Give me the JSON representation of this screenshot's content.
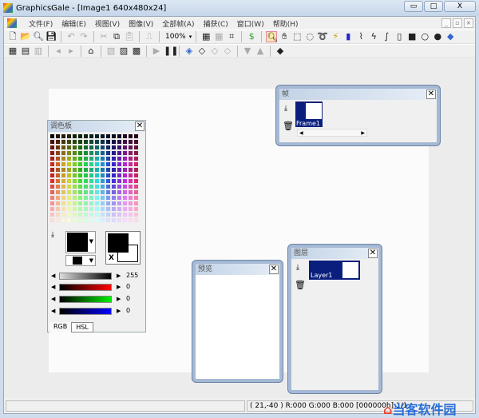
{
  "window": {
    "title": "GraphicsGale - [Image1 640x480x24]",
    "min": "▭",
    "max": "□",
    "close": "X"
  },
  "menu": [
    "文件(F)",
    "编辑(E)",
    "视图(V)",
    "图像(V)",
    "全部帧(A)",
    "捕获(C)",
    "窗口(W)",
    "帮助(H)"
  ],
  "mdi": [
    "_",
    "▫",
    "×"
  ],
  "toolbar1": {
    "zoom": "100%"
  },
  "palette": {
    "title": "调色板",
    "close": "✕",
    "gray_value": "255",
    "r": "0",
    "g": "0",
    "b": "0",
    "tabs": [
      "RGB",
      "HSL"
    ],
    "swap": "X"
  },
  "frames": {
    "title": "帧",
    "close": "✕",
    "frame_name": "Frame1"
  },
  "preview": {
    "title": "预览",
    "close": "✕"
  },
  "layers": {
    "title": "图层",
    "close": "✕",
    "layer_name": "Layer1"
  },
  "status": {
    "coords": "( 21,-40 ) R:000 G:000 B:000 [000000h] 1/1"
  },
  "watermark": "当客软件园"
}
